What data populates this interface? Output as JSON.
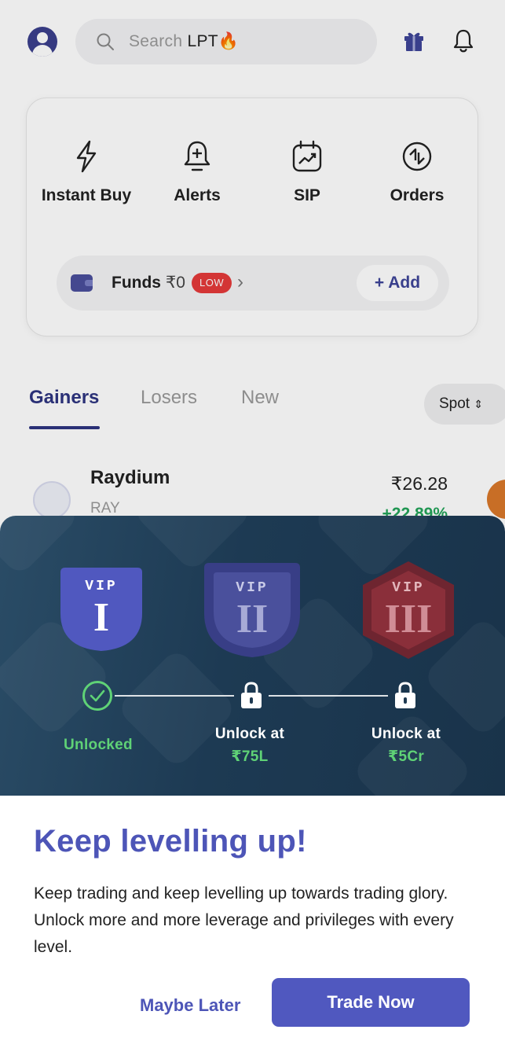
{
  "header": {
    "search_prefix": "Search ",
    "search_term": "LPT",
    "search_emoji": "🔥",
    "icons": [
      "profile-avatar",
      "search-icon",
      "gift-icon",
      "bell-icon"
    ]
  },
  "quick_actions": [
    {
      "label": "Instant Buy",
      "icon": "lightning-icon"
    },
    {
      "label": "Alerts",
      "icon": "alarm-plus-icon"
    },
    {
      "label": "SIP",
      "icon": "calendar-chart-icon"
    },
    {
      "label": "Orders",
      "icon": "exchange-icon"
    }
  ],
  "funds": {
    "label": "Funds",
    "amount": "₹0",
    "badge": "LOW",
    "add_label": "Add"
  },
  "market_tabs": {
    "items": [
      "Gainers",
      "Losers",
      "New"
    ],
    "active": "Gainers",
    "filter": "Spot"
  },
  "asset_row": {
    "name": "Raydium",
    "symbol": "RAY",
    "price": "₹26.28",
    "change": "+22.89%"
  },
  "vip": {
    "tiers": [
      {
        "tag": "VIP",
        "numeral": "I",
        "status": "Unlocked",
        "color": "#5058bf"
      },
      {
        "tag": "VIP",
        "numeral": "II",
        "status_line1": "Unlock at",
        "amount": "₹75L",
        "color": "#3f448f"
      },
      {
        "tag": "VIP",
        "numeral": "III",
        "status_line1": "Unlock at",
        "amount": "₹5Cr",
        "color": "#8a2a33"
      }
    ],
    "accent_green": "#5fd276"
  },
  "sheet": {
    "headline": "Keep levelling up!",
    "description": "Keep trading and keep levelling up towards trading glory. Unlock more and more leverage and privileges with every level.",
    "secondary_button": "Maybe Later",
    "primary_button": "Trade Now",
    "accent": "#4d55b7"
  }
}
